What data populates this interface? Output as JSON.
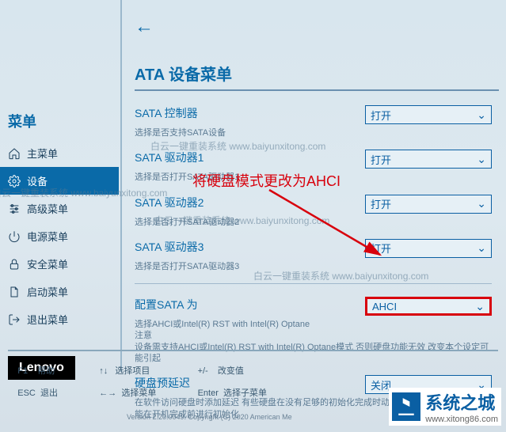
{
  "sidebar": {
    "title": "菜单",
    "items": [
      {
        "label": "主菜单"
      },
      {
        "label": "设备"
      },
      {
        "label": "高级菜单"
      },
      {
        "label": "电源菜单"
      },
      {
        "label": "安全菜单"
      },
      {
        "label": "启动菜单"
      },
      {
        "label": "退出菜单"
      }
    ]
  },
  "page": {
    "title": "ATA 设备菜单"
  },
  "rows": {
    "sata_ctrl": {
      "label": "SATA 控制器",
      "desc": "选择是否支持SATA设备",
      "value": "打开"
    },
    "sata_drv1": {
      "label": "SATA 驱动器1",
      "desc": "选择是否打开SATA驱动器1",
      "value": "打开"
    },
    "sata_drv2": {
      "label": "SATA 驱动器2",
      "desc": "选择是否打开SATA驱动器2",
      "value": "打开"
    },
    "sata_drv3": {
      "label": "SATA 驱动器3",
      "desc": "选择是否打开SATA驱动器3",
      "value": "打开"
    },
    "config_sata": {
      "label": "配置SATA 为",
      "desc1": "选择AHCI或Intel(R) RST with Intel(R) Optane",
      "desc2": "注意",
      "desc3": "设备需支持AHCI或Intel(R) RST with Intel(R) Optane模式 否则硬盘功能无效 改变本个设定可能引起",
      "value": "AHCI"
    },
    "hdd_pre": {
      "label": "硬盘预延迟",
      "desc": "在软件访问硬盘时添加延迟 有些硬盘在没有足够的初始化完成时动作延时 此项延迟保证硬盘能在开机完成前进行初始化",
      "value": "关闭"
    }
  },
  "footer": {
    "f1": "F1    帮助",
    "esc": "ESC  退出",
    "arrows1": "↑↓   选择项目",
    "arrows2": "←→  选择菜单",
    "pm": "+/-    改变值",
    "enter": "Enter  选择子菜单"
  },
  "version": "Version 2.20.0049. Copyright (C) 2020 American Me",
  "lenovo": "Lenovo",
  "callout": "将硬盘模式更改为AHCI",
  "watermarks": {
    "w1": "白云一键重装系统 www.baiyunxitong.com",
    "w2": "白云一键重装系统 www.baiyunxitong.com",
    "w3": "白云一键重装系统 www.baiyunxitong.com",
    "w4": "白云一键重装系统 www.baiyunxitong.com"
  },
  "logo": {
    "text": "系统之城",
    "sub": "www.xitong86.com"
  }
}
